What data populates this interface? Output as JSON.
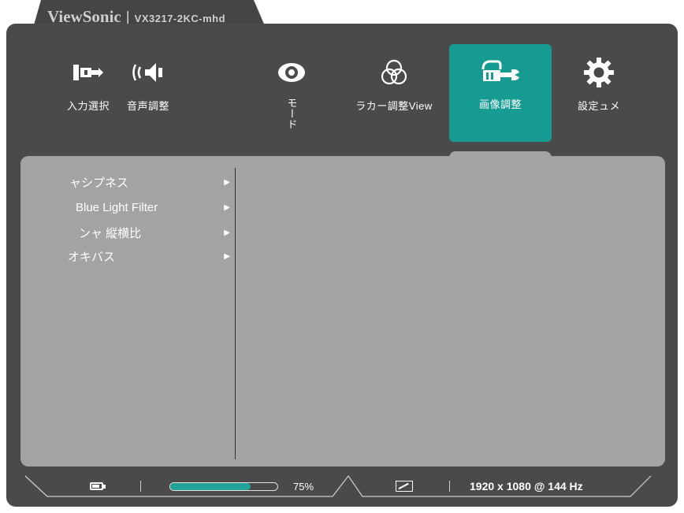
{
  "brand": {
    "name": "ViewSonic",
    "separator": "|",
    "model": "VX3217-2KC-mhd"
  },
  "top_menu": [
    {
      "label": "入力選択",
      "icon": "input-source-icon"
    },
    {
      "label": "音声調整",
      "icon": "audio-icon"
    },
    {
      "label": "モード",
      "icon": "eye-icon"
    },
    {
      "label": "ラカー調整View",
      "icon": "color-circles-icon"
    },
    {
      "label": "画像調整",
      "icon": "wrench-hand-icon",
      "active": true
    },
    {
      "label": "設定ュメ",
      "icon": "gear-icon"
    }
  ],
  "submenu": [
    {
      "label": "ャシプネス",
      "arrow": "▶"
    },
    {
      "label": "Blue Light Filter",
      "arrow": "▶"
    },
    {
      "label": "ンャ 縦横比",
      "arrow": "▶"
    },
    {
      "label": "オキバス",
      "arrow": "▶"
    }
  ],
  "status_bar": {
    "battery_icon": "battery-icon",
    "progress": 0.75,
    "percent_label": "75%",
    "aspect_icon": "aspect-ratio-icon",
    "resolution": "1920 x 1080 @ 144 Hz"
  },
  "colors": {
    "accent": "#169b93",
    "frame": "#4a4a4a",
    "panel": "#a1a3a4"
  }
}
